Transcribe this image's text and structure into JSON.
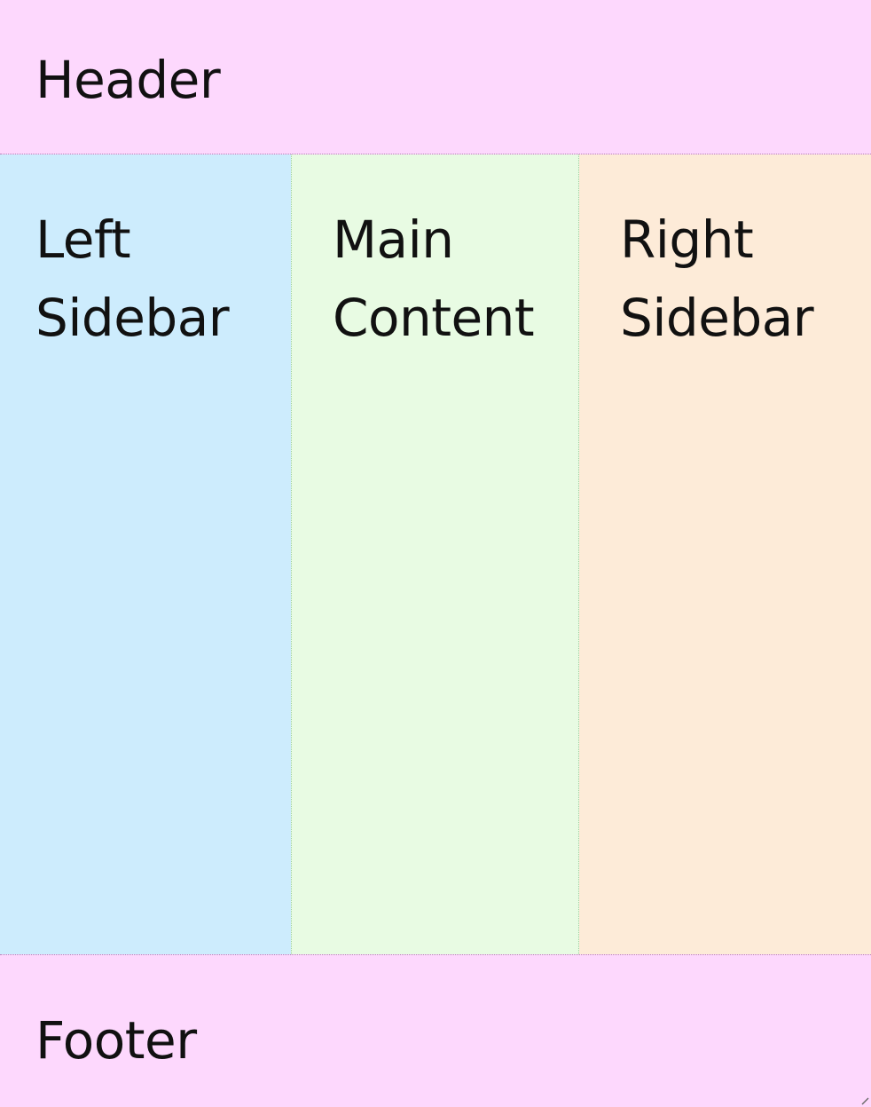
{
  "header": {
    "label": "Header",
    "color": "#fdd8fd"
  },
  "left_sidebar": {
    "label": "Left\nSidebar",
    "color": "#cdecfd"
  },
  "main_content": {
    "label": "Main\nContent",
    "color": "#e8fbe3"
  },
  "right_sidebar": {
    "label": "Right\nSidebar",
    "color": "#fdebd8"
  },
  "footer": {
    "label": "Footer",
    "color": "#fdd8fd"
  },
  "icons": {
    "resize": "resize-grip-icon"
  }
}
